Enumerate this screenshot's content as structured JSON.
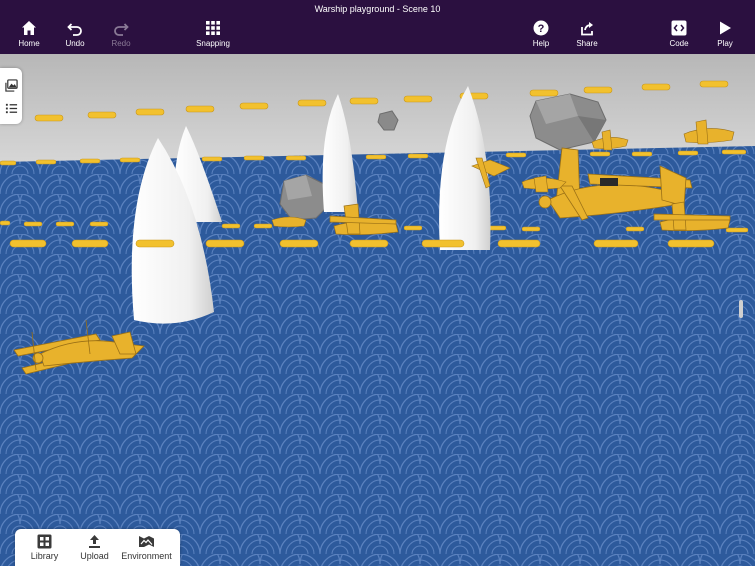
{
  "window": {
    "title": "Warship playground - Scene 10"
  },
  "toolbar": {
    "home_label": "Home",
    "undo_label": "Undo",
    "redo_label": "Redo",
    "snapping_label": "Snapping",
    "help_label": "Help",
    "share_label": "Share",
    "code_label": "Code",
    "play_label": "Play"
  },
  "side_panel": {
    "icons": [
      "gallery-icon",
      "list-icon"
    ]
  },
  "bottom_bar": {
    "library_label": "Library",
    "upload_label": "Upload",
    "environment_label": "Environment"
  },
  "colors": {
    "header": "#2b1040",
    "sky": "#c8c8c8",
    "water": "#2d5a9c",
    "wave_line": "#5f84bf",
    "biplane": "#e8b22c",
    "buoy": "#f2c12e",
    "spike": "#f2f2f2",
    "rock": "#8a8a8a"
  }
}
